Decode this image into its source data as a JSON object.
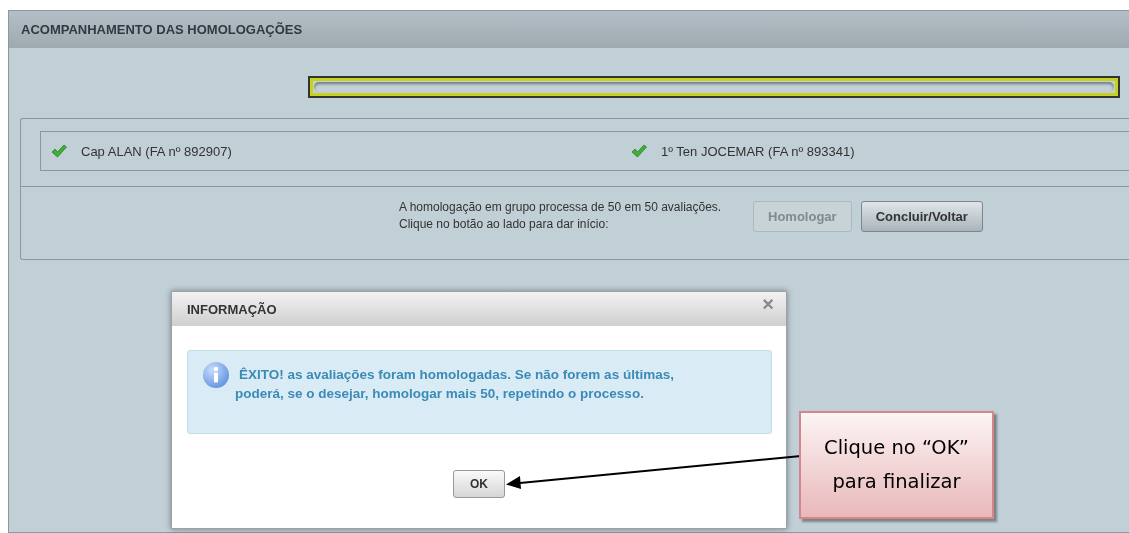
{
  "panel": {
    "title": "ACOMPANHAMENTO DAS HOMOLOGAÇÕES"
  },
  "progress": {
    "level": 0
  },
  "evaluations": [
    {
      "name": "Cap ALAN (FA nº 892907)",
      "checked": true
    },
    {
      "name": "1º Ten JOCEMAR (FA nº 893341)",
      "checked": true
    }
  ],
  "instructions": "A homologação em grupo processa de 50 em 50 avaliações. Clique no botão ao lado para dar início:",
  "buttons": [
    {
      "label": "Homologar",
      "disabled": true
    },
    {
      "label": "Concluir/Voltar",
      "disabled": false
    }
  ],
  "dialog": {
    "title": "INFORMAÇÃO",
    "close": "×",
    "message": "ÊXITO! as avaliações foram homologadas. Se não forem as últimas, poderá, se o desejar, homologar mais 50, repetindo o processo.",
    "button": "OK"
  },
  "callout": {
    "text": "Clique no “OK” para finalizar"
  }
}
